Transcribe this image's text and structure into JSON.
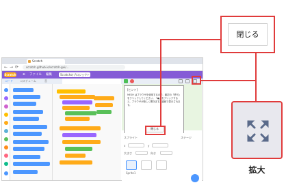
{
  "browser": {
    "tab_title": "Scratch",
    "url": "scratch.github.io/scratch-gui/...",
    "nav_back": "←",
    "nav_forward": "→",
    "nav_reload": "⟳"
  },
  "menubar": {
    "logo": "Scratch",
    "items": [
      "ファイル",
      "編集"
    ],
    "project_name": "Scratchのプロジェクト"
  },
  "editor_tabs": [
    "コード",
    "コスチューム",
    "音"
  ],
  "dialog": {
    "title": "[ヒント]",
    "body": "MESH はブラウザを使用するので、最初の「許可」をクリックしてください。「●」をクリックすると、ブラウザが新しく開きます。連続で表示されます。",
    "close_label": "閉じる"
  },
  "sprite_pane": {
    "sprite_label": "スプライト",
    "x_label": "x",
    "y_label": "y",
    "size_label": "大きさ",
    "direction_label": "向き",
    "sprite_name": "Sprite1",
    "stage_label": "ステージ"
  },
  "callouts": {
    "close_label": "閉じる",
    "expand_caption": "拡大",
    "expand_icon": "expand-arrows-icon"
  },
  "colors": {
    "highlight": "#e03b3b",
    "menubar": "#855cd6",
    "motion": "#4c97ff",
    "looks": "#9966ff",
    "events": "#ffbf00",
    "control": "#ffab19",
    "operators": "#59c059"
  }
}
